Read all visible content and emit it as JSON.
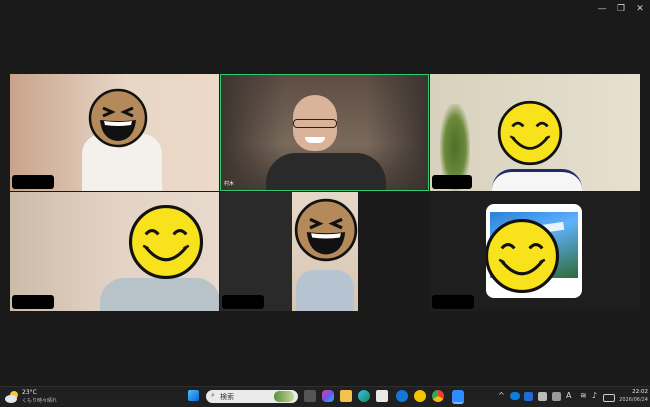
{
  "window": {
    "minimize": "—",
    "restore": "❐",
    "close": "✕"
  },
  "participants": [
    {
      "id": "p1",
      "label": ""
    },
    {
      "id": "p2",
      "label": "村木"
    },
    {
      "id": "p3",
      "label": ""
    },
    {
      "id": "p4",
      "label": ""
    },
    {
      "id": "p5",
      "label": ""
    },
    {
      "id": "p6",
      "label": ""
    },
    {
      "id": "p7",
      "label": ""
    }
  ],
  "colors": {
    "active_speaker_border": "#2ecc71",
    "emoji_yellow": "#f7e21b",
    "emoji_tan": "#b58a5a"
  },
  "taskbar": {
    "weather_temp": "23°C",
    "weather_desc": "くもり時々晴れ",
    "search_placeholder": "検索",
    "ime": "A",
    "time": "22:02",
    "date": "2026/06/24",
    "icons": [
      "start-icon",
      "search-icon",
      "task-view-icon",
      "copilot-icon",
      "file-explorer-icon",
      "edge-icon",
      "chrome-icon",
      "store-icon",
      "hp-icon",
      "norton-icon",
      "chrome-icon-2",
      "zoom-icon"
    ]
  }
}
